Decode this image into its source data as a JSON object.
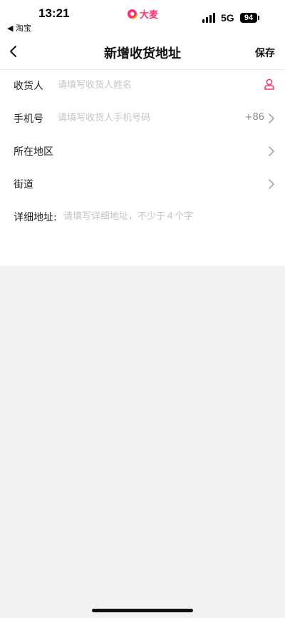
{
  "status_bar": {
    "time": "13:21",
    "back_app": "◀ 淘宝",
    "app_name": "大麦",
    "network": "5G",
    "battery": "94"
  },
  "nav": {
    "title": "新增收货地址",
    "save_label": "保存",
    "back_icon": "chevron-left-icon"
  },
  "form": {
    "recipient": {
      "label": "收货人",
      "placeholder": "请填写收货人姓名",
      "icon": "person-icon"
    },
    "phone": {
      "label": "手机号",
      "placeholder": "请填写收货人手机号码",
      "country_code": "+86"
    },
    "region": {
      "label": "所在地区"
    },
    "street": {
      "label": "街道"
    },
    "detail": {
      "label": "详细地址:",
      "placeholder": "请填写详细地址，不少于４个字"
    }
  },
  "colors": {
    "accent": "#ff2e6d",
    "placeholder": "#c4c4c4",
    "page_background": "#f2f2f2"
  }
}
